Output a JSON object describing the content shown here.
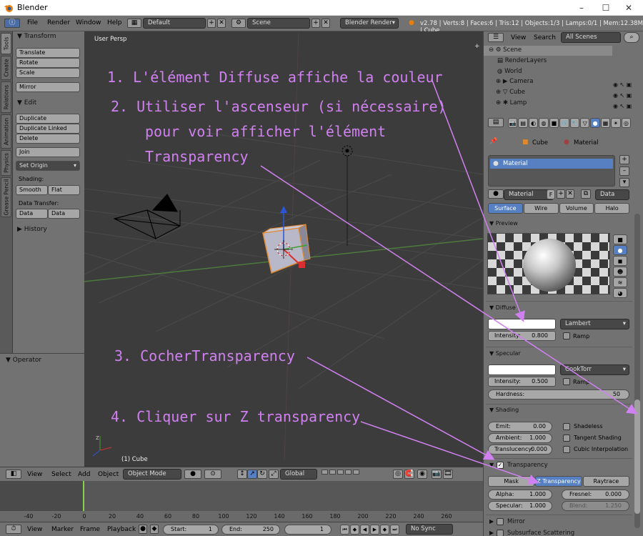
{
  "window": {
    "title": "Blender"
  },
  "menu": {
    "items": [
      "File",
      "Render",
      "Window",
      "Help"
    ],
    "layout": "Default",
    "scene": "Scene",
    "engine": "Blender Render",
    "stats": "v2.78 | Verts:8 | Faces:6 | Tris:12 | Objects:1/3 | Lamps:0/1 | Mem:12.38M | Cube"
  },
  "tool_tabs": [
    "Tools",
    "Create",
    "Relations",
    "Animation",
    "Physics",
    "Grease Pencil"
  ],
  "tools": {
    "transform_label": "Transform",
    "translate": "Translate",
    "rotate": "Rotate",
    "scale": "Scale",
    "mirror": "Mirror",
    "edit_label": "Edit",
    "duplicate": "Duplicate",
    "duplicate_linked": "Duplicate Linked",
    "delete": "Delete",
    "join": "Join",
    "set_origin": "Set Origin",
    "shading_label": "Shading:",
    "smooth": "Smooth",
    "flat": "Flat",
    "data_transfer_label": "Data Transfer:",
    "data": "Data",
    "data_layo": "Data Layo",
    "history_label": "History"
  },
  "operator": {
    "label": "Operator"
  },
  "viewport": {
    "view_label": "User Persp",
    "object_label": "(1) Cube"
  },
  "view3d_header": {
    "menus": [
      "View",
      "Select",
      "Add",
      "Object"
    ],
    "mode": "Object Mode",
    "orientation": "Global"
  },
  "timeline": {
    "ticks": [
      "-40",
      "-20",
      "0",
      "20",
      "40",
      "60",
      "80",
      "100",
      "120",
      "140",
      "160",
      "180",
      "200",
      "220",
      "240",
      "260"
    ],
    "menus": [
      "View",
      "Marker",
      "Frame",
      "Playback"
    ],
    "start_label": "Start:",
    "start": "1",
    "end_label": "End:",
    "end": "250",
    "frame": "1",
    "sync": "No Sync"
  },
  "outliner": {
    "view": "View",
    "search": "Search",
    "scope": "All Scenes",
    "items": [
      "Scene",
      "RenderLayers",
      "World",
      "Camera",
      "Cube",
      "Lamp"
    ]
  },
  "props": {
    "breadcrumb_cube": "Cube",
    "breadcrumb_material": "Material",
    "slot": "Material",
    "mat_name": "Material",
    "mat_users": "F",
    "data_dd": "Data",
    "tabs": [
      "Surface",
      "Wire",
      "Volume",
      "Halo"
    ],
    "preview": "Preview",
    "diffuse": "Diffuse",
    "diffuse_shader": "Lambert",
    "diffuse_intensity": "Intensity:",
    "diffuse_intensity_val": "0.800",
    "ramp": "Ramp",
    "specular": "Specular",
    "spec_shader": "CookTorr",
    "spec_intensity": "Intensity:",
    "spec_intensity_val": "0.500",
    "hardness": "Hardness:",
    "hardness_val": "50",
    "shading": "Shading",
    "emit": "Emit:",
    "emit_val": "0.00",
    "ambient": "Ambient:",
    "ambient_val": "1.000",
    "translucency": "Translucency:",
    "translucency_val": "0.000",
    "shadeless": "Shadeless",
    "tangent": "Tangent Shading",
    "cubic": "Cubic Interpolation",
    "transparency": "Transparency",
    "mask": "Mask",
    "ztrans": "Z Transparency",
    "raytrace": "Raytrace",
    "alpha": "Alpha:",
    "alpha_val": "1.000",
    "fresnel": "Fresnel:",
    "fresnel_val": "0.000",
    "specular2": "Specular:",
    "specular2_val": "1.000",
    "blend": "Blend:",
    "blend_val": "1.250",
    "mirror": "Mirror",
    "sss": "Subsurface Scattering"
  },
  "annotations": {
    "a1": "1. L'élément Diffuse affiche la couleur",
    "a2a": "2. Utiliser l'ascenseur (si nécessaire)",
    "a2b": "pour voir afficher l'élément",
    "a2c": "Transparency",
    "a3": "3. CocherTransparency",
    "a4": "4. Cliquer sur Z transparency"
  },
  "colors": {
    "annotation": "#d080f0",
    "selected": "#5680c2"
  }
}
